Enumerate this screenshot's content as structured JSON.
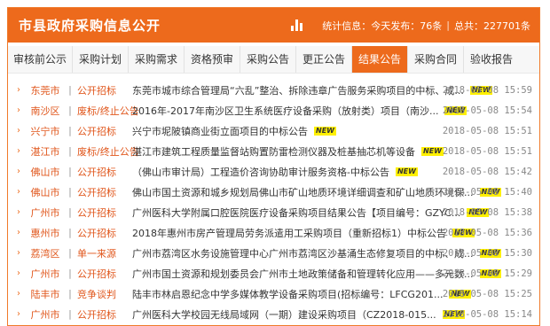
{
  "header": {
    "title": "市县政府采购信息公开",
    "stats_label": "统计信息：今天发布：76条",
    "sep": "|",
    "total_label": "总共：227701条",
    "stats_icon": "bar-chart-icon"
  },
  "tabs": [
    {
      "label": "审核前公示"
    },
    {
      "label": "采购计划"
    },
    {
      "label": "采购需求"
    },
    {
      "label": "资格预审"
    },
    {
      "label": "采购公告"
    },
    {
      "label": "更正公告"
    },
    {
      "label": "结果公告",
      "active": true
    },
    {
      "label": "采购合同"
    },
    {
      "label": "验收报告"
    }
  ],
  "rows": [
    {
      "region": "东莞市",
      "type": "公开招标",
      "title": "东莞市城市综合管理局“六乱”整治、拆除违章广告服务采购项目的中标、成...",
      "new": "NEW",
      "date": "2018-05-08 15:59"
    },
    {
      "region": "南沙区",
      "type": "废标/终止公告",
      "title": "2016年-2017年南沙区卫生系统医疗设备采购（放射类）项目（南沙...",
      "new": "NEW",
      "date": "2018-05-08 15:54"
    },
    {
      "region": "兴宁市",
      "type": "公开招标",
      "title": "兴宁市坭陂镇商业街立面项目的中标公告",
      "new": "NEW",
      "date": "2018-05-08 15:51"
    },
    {
      "region": "湛江市",
      "type": "废标/终止公告",
      "title": "湛江市建筑工程质量监督站购置防雷检测仪器及桩基抽芯机等设备",
      "new": "NEW",
      "date": "2018-05-08 15:51"
    },
    {
      "region": "佛山市",
      "type": "公开招标",
      "title": "（佛山市审计局）工程造价咨询协助审计服务资格-中标公告",
      "new": "NEW",
      "date": "2018-05-08 15:42"
    },
    {
      "region": "佛山市",
      "type": "公开招标",
      "title": "佛山市国土资源和城乡规划局佛山市矿山地质环境详细调查和矿山地质环境保...",
      "new": "NEW",
      "date": "2018-05-08 15:40"
    },
    {
      "region": "广州市",
      "type": "公开招标",
      "title": "广州医科大学附属口腔医院医疗设备采购项目结果公告【项目编号：GZYC...",
      "new": "NEW",
      "date": "2018-05-08 15:38"
    },
    {
      "region": "惠州市",
      "type": "公开招标",
      "title": "2018年惠州市房产管理局劳务派遣用工采购项目（重新招标1）中标公告",
      "new": "NEW",
      "date": "2018-05-08 15:36"
    },
    {
      "region": "荔湾区",
      "type": "单一来源",
      "title": "广州市荔湾区水务设施管理中心广州市荔湾区沙基涌生态修复项目的中标、成...",
      "new": "NEW",
      "date": "2018-05-08 15:30"
    },
    {
      "region": "广州市",
      "type": "公开招标",
      "title": "广州市国土资源和规划委员会广州市土地政策储备和管理转化应用——多元数...",
      "new": "NEW",
      "date": "2018-05-08 15:29"
    },
    {
      "region": "陆丰市",
      "type": "竞争谈判",
      "title": "陆丰市林启恩纪念中学多媒体教学设备采购项目(招标编号：LFCG201...",
      "new": "NEW",
      "date": "2018-05-08 15:25"
    },
    {
      "region": "广州市",
      "type": "公开招标",
      "title": "广州医科大学校园无线局域网（一期）建设采购项目（CZ2018-015...",
      "new": "NEW",
      "date": "2018-05-08 15:14"
    }
  ]
}
